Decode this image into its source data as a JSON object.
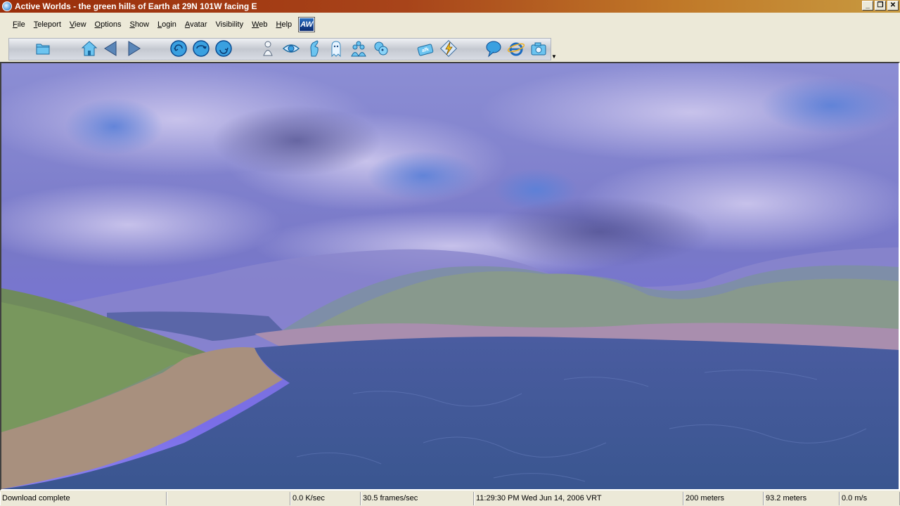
{
  "window": {
    "title": "Active Worlds - the green hills of Earth at 29N 101W facing E",
    "buttons": {
      "minimize": "_",
      "restore": "❐",
      "close": "✕"
    }
  },
  "menu": {
    "items": [
      {
        "u": "F",
        "rest": "ile"
      },
      {
        "u": "T",
        "rest": "eleport"
      },
      {
        "u": "V",
        "rest": "iew"
      },
      {
        "u": "O",
        "rest": "ptions"
      },
      {
        "u": "S",
        "rest": "how"
      },
      {
        "u": "L",
        "rest": "ogin"
      },
      {
        "u": "A",
        "rest": "vatar"
      },
      {
        "u": "",
        "rest": "Visibility"
      },
      {
        "u": "W",
        "rest": "eb"
      },
      {
        "u": "H",
        "rest": "elp"
      }
    ],
    "logo": "AW"
  },
  "toolbar": {
    "icons": [
      "folder-icon",
      "home-icon",
      "back-icon",
      "forward-icon",
      "turn-left-icon",
      "turn-around-icon",
      "turn-right-icon",
      "avatar-icon",
      "eye-icon",
      "hand-icon",
      "ghost-icon",
      "people-icon",
      "gestures-icon",
      "afk-icon",
      "teleport-lightning-icon",
      "chat-bubble-icon",
      "browser-icon",
      "camera-icon"
    ],
    "afk_label": "afk"
  },
  "status": {
    "message": "Download complete",
    "blank": "",
    "transfer": "0.0 K/sec",
    "fps": "30.5 frames/sec",
    "datetime": "11:29:30 PM Wed Jun 14, 2006 VRT",
    "visibility": "200 meters",
    "altitude": "93.2 meters",
    "speed": "0.0 m/s"
  },
  "colors": {
    "titlebar_start": "#9a2e0a",
    "titlebar_end": "#c89a40",
    "chrome": "#ece9d8",
    "icon_blue": "#3aa0e0"
  }
}
